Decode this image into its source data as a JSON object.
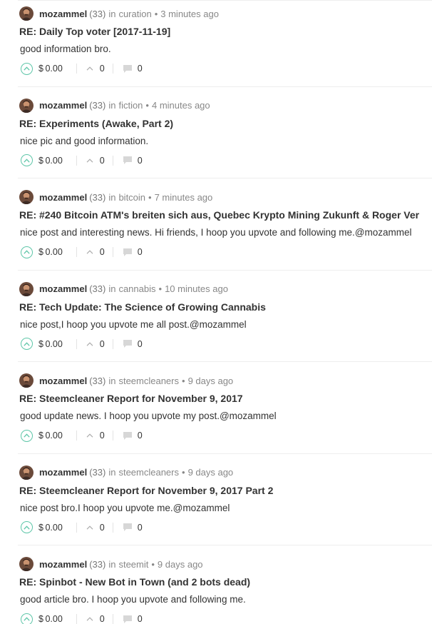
{
  "accent_color": "#5ec6a8",
  "icons": {
    "upvote": "upvote-chevron-circle-icon",
    "voters": "chevron-up-icon",
    "replies": "comment-bubble-icon"
  },
  "comments": [
    {
      "author": "mozammel",
      "reputation": "(33)",
      "in": "in",
      "category": "curation",
      "separator": "•",
      "time": "3 minutes ago",
      "title": "RE: Daily Top voter [2017-11-19]",
      "body": "good information bro.",
      "payout": "$ 0.00",
      "votes": "0",
      "replies": "0"
    },
    {
      "author": "mozammel",
      "reputation": "(33)",
      "in": "in",
      "category": "fiction",
      "separator": "•",
      "time": "4 minutes ago",
      "title": "RE: Experiments (Awake, Part 2)",
      "body": "nice pic and good information.",
      "payout": "$ 0.00",
      "votes": "0",
      "replies": "0"
    },
    {
      "author": "mozammel",
      "reputation": "(33)",
      "in": "in",
      "category": "bitcoin",
      "separator": "•",
      "time": "7 minutes ago",
      "title": "RE: #240 Bitcoin ATM's breiten sich aus, Quebec Krypto Mining Zukunft & Roger Ver",
      "body": "nice post and interesting news. Hi friends, I hoop you upvote and following me.@mozammel",
      "payout": "$ 0.00",
      "votes": "0",
      "replies": "0"
    },
    {
      "author": "mozammel",
      "reputation": "(33)",
      "in": "in",
      "category": "cannabis",
      "separator": "•",
      "time": "10 minutes ago",
      "title": "RE: Tech Update: The Science of Growing Cannabis",
      "body": "nice post,I hoop you upvote me all post.@mozammel",
      "payout": "$ 0.00",
      "votes": "0",
      "replies": "0"
    },
    {
      "author": "mozammel",
      "reputation": "(33)",
      "in": "in",
      "category": "steemcleaners",
      "separator": "•",
      "time": "9 days ago",
      "title": "RE: Steemcleaner Report for November 9, 2017",
      "body": "good update news. I hoop you upvote my post.@mozammel",
      "payout": "$ 0.00",
      "votes": "0",
      "replies": "0"
    },
    {
      "author": "mozammel",
      "reputation": "(33)",
      "in": "in",
      "category": "steemcleaners",
      "separator": "•",
      "time": "9 days ago",
      "title": "RE: Steemcleaner Report for November 9, 2017 Part 2",
      "body": "nice post bro.I hoop you upvote me.@mozammel",
      "payout": "$ 0.00",
      "votes": "0",
      "replies": "0"
    },
    {
      "author": "mozammel",
      "reputation": "(33)",
      "in": "in",
      "category": "steemit",
      "separator": "•",
      "time": "9 days ago",
      "title": "RE: Spinbot - New Bot in Town (and 2 bots dead)",
      "body": "good article bro. I hoop you upvote and following me.",
      "payout": "$ 0.00",
      "votes": "0",
      "replies": "0"
    }
  ]
}
